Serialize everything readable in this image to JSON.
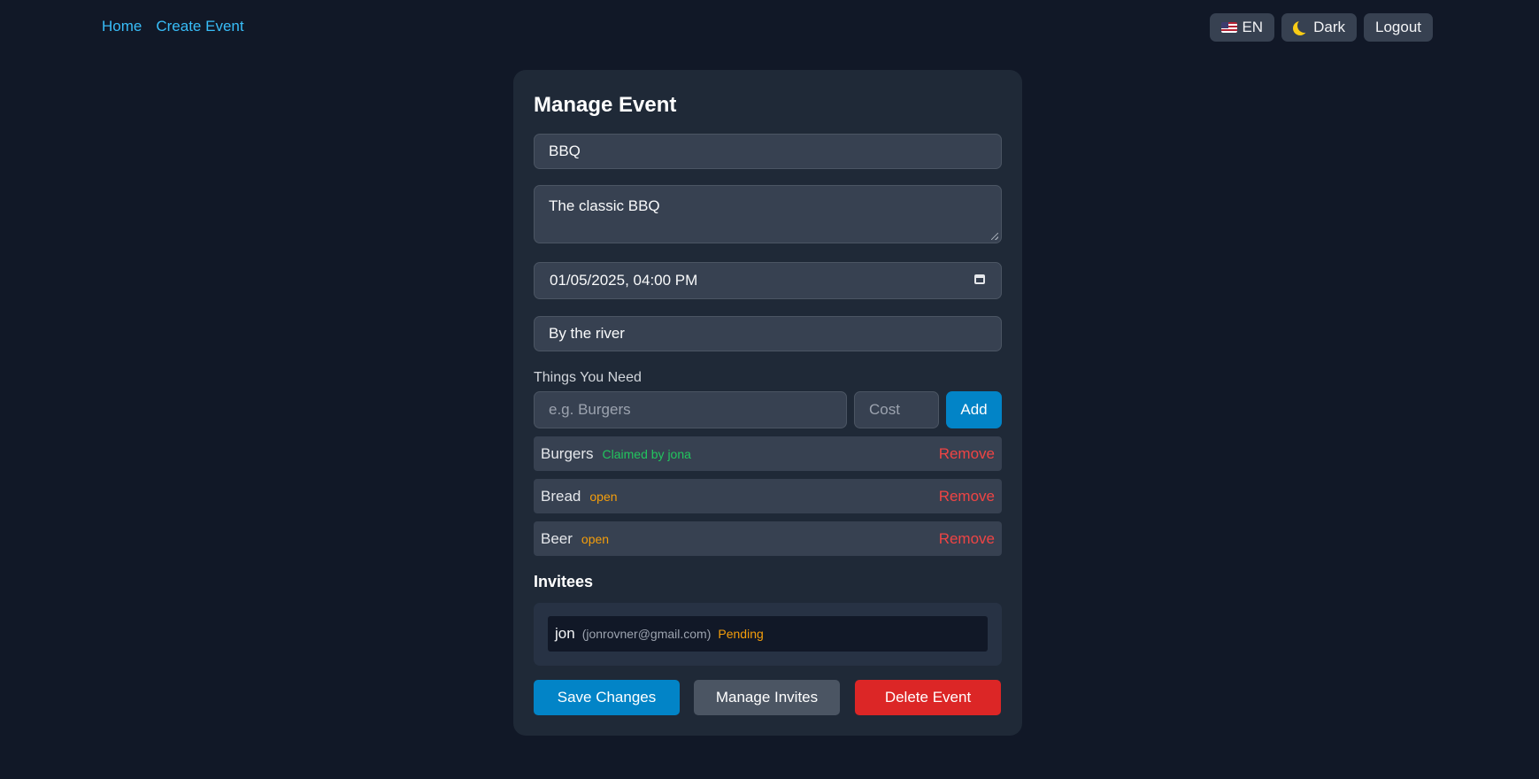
{
  "nav": {
    "home": "Home",
    "create_event": "Create Event"
  },
  "controls": {
    "language": "EN",
    "theme": "Dark",
    "logout": "Logout"
  },
  "form": {
    "title": "Manage Event",
    "name": "BBQ",
    "description": "The classic BBQ",
    "datetime": "01/05/2025, 04:00 PM",
    "location": "By the river"
  },
  "things": {
    "label": "Things You Need",
    "item_placeholder": "e.g. Burgers",
    "cost_placeholder": "Cost",
    "add_label": "Add",
    "remove_label": "Remove",
    "items": [
      {
        "name": "Burgers",
        "status": "Claimed by jona",
        "status_type": "claimed"
      },
      {
        "name": "Bread",
        "status": "open",
        "status_type": "open"
      },
      {
        "name": "Beer",
        "status": "open",
        "status_type": "open"
      }
    ]
  },
  "invitees": {
    "title": "Invitees",
    "list": [
      {
        "name": "jon",
        "email": "(jonrovner@gmail.com)",
        "status": "Pending"
      }
    ]
  },
  "actions": {
    "save": "Save Changes",
    "manage_invites": "Manage Invites",
    "delete": "Delete Event"
  },
  "colors": {
    "background": "#111827",
    "card": "#1f2937",
    "accent": "#0284c7",
    "danger": "#dc2626",
    "claimed": "#22c55e",
    "open": "#f59e0b"
  }
}
